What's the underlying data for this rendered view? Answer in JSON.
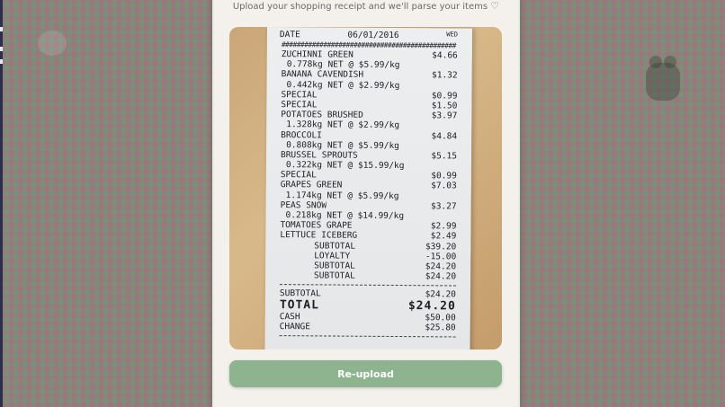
{
  "upload": {
    "hint": "Upload your shopping receipt and we'll parse your items",
    "heart_icon": "♡"
  },
  "receipt": {
    "date_label": "DATE",
    "date": "06/01/2016",
    "day": "WED",
    "hash_line": "##############################################",
    "lines": [
      {
        "name": "ZUCHINNI GREEN",
        "amount": "$4.66",
        "style": ""
      },
      {
        "name": "0.778kg NET @ $5.99/kg",
        "amount": "",
        "style": "sub"
      },
      {
        "name": "BANANA CAVENDISH",
        "amount": "$1.32",
        "style": ""
      },
      {
        "name": "0.442kg NET @ $2.99/kg",
        "amount": "",
        "style": "sub"
      },
      {
        "name": "SPECIAL",
        "amount": "$0.99",
        "style": ""
      },
      {
        "name": "SPECIAL",
        "amount": "$1.50",
        "style": ""
      },
      {
        "name": "POTATOES BRUSHED",
        "amount": "$3.97",
        "style": ""
      },
      {
        "name": "1.328kg NET @ $2.99/kg",
        "amount": "",
        "style": "sub"
      },
      {
        "name": "BROCCOLI",
        "amount": "$4.84",
        "style": ""
      },
      {
        "name": "0.808kg NET @ $5.99/kg",
        "amount": "",
        "style": "sub"
      },
      {
        "name": "BRUSSEL SPROUTS",
        "amount": "$5.15",
        "style": ""
      },
      {
        "name": "0.322kg NET @ $15.99/kg",
        "amount": "",
        "style": "sub"
      },
      {
        "name": "SPECIAL",
        "amount": "$0.99",
        "style": ""
      },
      {
        "name": "GRAPES GREEN",
        "amount": "$7.03",
        "style": ""
      },
      {
        "name": "1.174kg NET @ $5.99/kg",
        "amount": "",
        "style": "sub"
      },
      {
        "name": "PEAS SNOW",
        "amount": "$3.27",
        "style": ""
      },
      {
        "name": "0.218kg NET @ $14.99/kg",
        "amount": "",
        "style": "sub"
      },
      {
        "name": "TOMATOES GRAPE",
        "amount": "$2.99",
        "style": ""
      },
      {
        "name": "LETTUCE ICEBERG",
        "amount": "$2.49",
        "style": ""
      },
      {
        "name": "SUBTOTAL",
        "amount": "$39.20",
        "style": "indent"
      },
      {
        "name": "LOYALTY",
        "amount": "-15.00",
        "style": "indent"
      },
      {
        "name": "SUBTOTAL",
        "amount": "$24.20",
        "style": "indent"
      },
      {
        "name": "SUBTOTAL",
        "amount": "$24.20",
        "style": "indent"
      }
    ],
    "totals": [
      {
        "name": "SUBTOTAL",
        "amount": "$24.20",
        "style": ""
      },
      {
        "name": "TOTAL",
        "amount": "$24.20",
        "style": "big"
      },
      {
        "name": "CASH",
        "amount": "$50.00",
        "style": ""
      },
      {
        "name": "CHANGE",
        "amount": "$25.80",
        "style": ""
      }
    ]
  },
  "actions": {
    "reupload_label": "Re-upload"
  },
  "colors": {
    "button": "#8db48e",
    "panel": "#f4f1ec"
  }
}
